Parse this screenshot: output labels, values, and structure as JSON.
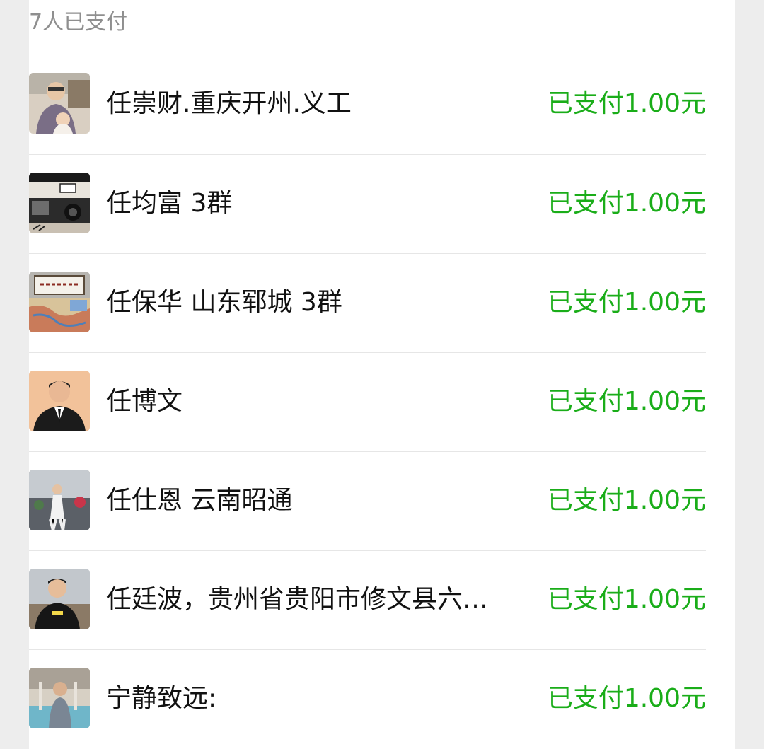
{
  "header": {
    "title": "7人已支付"
  },
  "colors": {
    "accent_green": "#1aad19",
    "muted": "#8f8f8f"
  },
  "payers": [
    {
      "name": "任崇财.重庆开州.义工",
      "status": "已支付1.00元",
      "avatar": "person-with-child-photo"
    },
    {
      "name": "任均富 3群",
      "status": "已支付1.00元",
      "avatar": "car-photo-with-calligraphy"
    },
    {
      "name": "任保华 山东郓城 3群",
      "status": "已支付1.00元",
      "avatar": "map-and-plaque-photo"
    },
    {
      "name": "任博文",
      "status": "已支付1.00元",
      "avatar": "man-in-suit-portrait"
    },
    {
      "name": "任仕恩 云南昭通",
      "status": "已支付1.00元",
      "avatar": "person-outdoors-photo"
    },
    {
      "name": "任廷波，贵州省贵阳市修文县六…",
      "status": "已支付1.00元",
      "avatar": "man-in-black-tshirt-photo"
    },
    {
      "name": "宁静致远:",
      "status": "已支付1.00元",
      "avatar": "person-at-pool-photo"
    }
  ]
}
